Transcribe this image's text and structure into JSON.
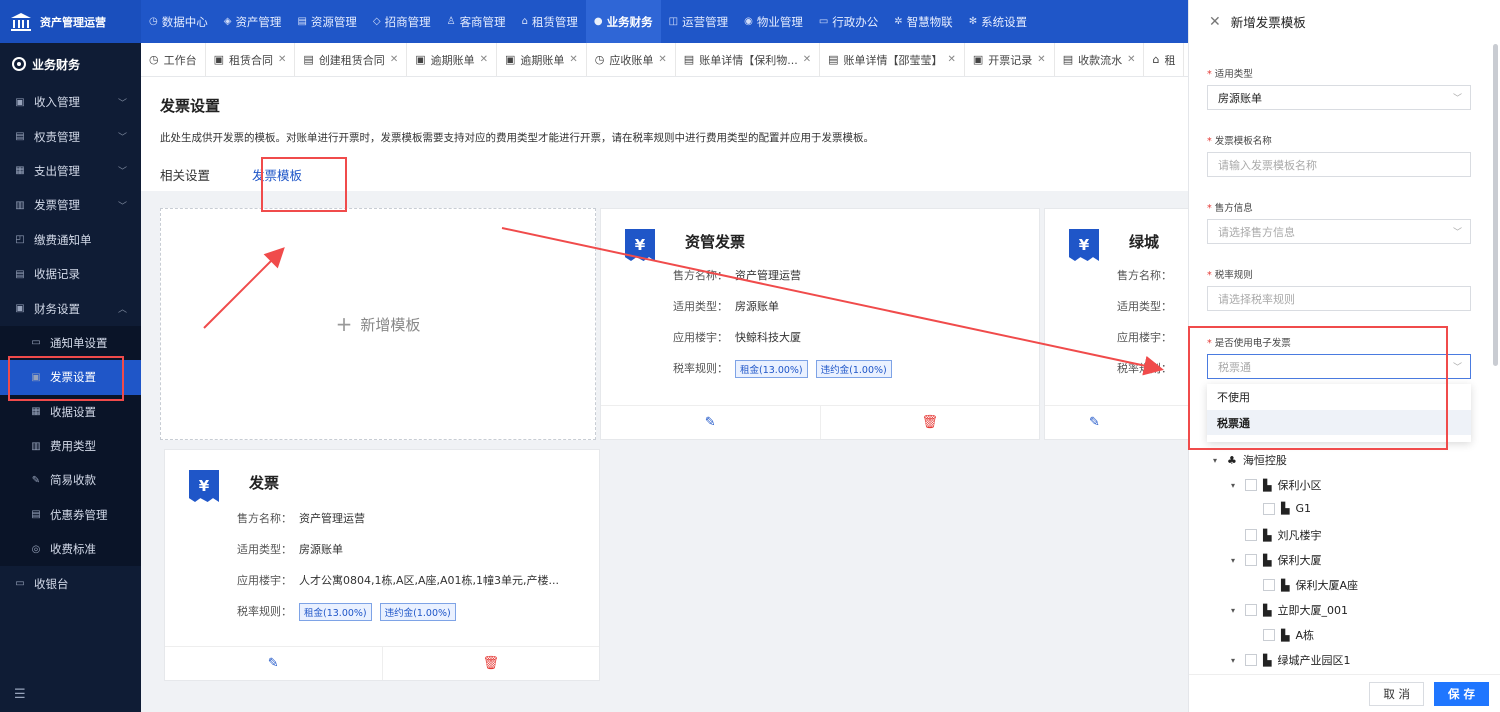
{
  "brand": {
    "name": "资产管理运营"
  },
  "topnav": [
    {
      "icon": "◷",
      "label": "数据中心"
    },
    {
      "icon": "◈",
      "label": "资产管理"
    },
    {
      "icon": "▤",
      "label": "资源管理"
    },
    {
      "icon": "◇",
      "label": "招商管理"
    },
    {
      "icon": "♙",
      "label": "客商管理"
    },
    {
      "icon": "⌂",
      "label": "租赁管理"
    },
    {
      "icon": "●",
      "label": "业务财务",
      "active": true
    },
    {
      "icon": "◫",
      "label": "运营管理"
    },
    {
      "icon": "◉",
      "label": "物业管理"
    },
    {
      "icon": "▭",
      "label": "行政办公"
    },
    {
      "icon": "✲",
      "label": "智慧物联"
    },
    {
      "icon": "✻",
      "label": "系统设置"
    }
  ],
  "sidebar": {
    "header": "业务财务",
    "items": [
      {
        "icon": "▣",
        "label": "收入管理",
        "chev": "﹀"
      },
      {
        "icon": "▤",
        "label": "权责管理",
        "chev": "﹀"
      },
      {
        "icon": "▦",
        "label": "支出管理",
        "chev": "﹀"
      },
      {
        "icon": "▥",
        "label": "发票管理",
        "chev": "﹀"
      },
      {
        "icon": "◰",
        "label": "缴费通知单"
      },
      {
        "icon": "▤",
        "label": "收据记录"
      },
      {
        "icon": "▣",
        "label": "财务设置",
        "chev": "︿"
      }
    ],
    "sub_items": [
      {
        "icon": "▭",
        "label": "通知单设置"
      },
      {
        "icon": "▣",
        "label": "发票设置",
        "active": true
      },
      {
        "icon": "▦",
        "label": "收据设置"
      },
      {
        "icon": "▥",
        "label": "费用类型"
      },
      {
        "icon": "✎",
        "label": "简易收款"
      },
      {
        "icon": "▤",
        "label": "优惠券管理"
      },
      {
        "icon": "◎",
        "label": "收费标准"
      }
    ],
    "last_item": {
      "icon": "▭",
      "label": "收银台"
    },
    "bottom_icon": "☰"
  },
  "tabs": [
    {
      "icon": "◷",
      "label": "工作台"
    },
    {
      "icon": "▣",
      "label": "租赁合同"
    },
    {
      "icon": "▤",
      "label": "创建租赁合同"
    },
    {
      "icon": "▣",
      "label": "逾期账单"
    },
    {
      "icon": "▣",
      "label": "逾期账单"
    },
    {
      "icon": "◷",
      "label": "应收账单"
    },
    {
      "icon": "▤",
      "label": "账单详情【保利物..."
    },
    {
      "icon": "▤",
      "label": "账单详情【邵莹莹】"
    },
    {
      "icon": "▣",
      "label": "开票记录"
    },
    {
      "icon": "▤",
      "label": "收款流水"
    },
    {
      "icon": "⌂",
      "label": "租"
    }
  ],
  "page": {
    "title": "发票设置",
    "desc": "此处生成供开发票的模板。对账单进行开票时，发票模板需要支持对应的费用类型才能进行开票，请在税率规则中进行费用类型的配置并应用于发票模板。",
    "tab_related": "相关设置",
    "tab_templates": "发票模板",
    "add_label": "新增模板",
    "add_icon": "+"
  },
  "cards": [
    {
      "icon": "¥",
      "title": "资管发票",
      "seller_label": "售方名称：",
      "seller": "资产管理运营",
      "type_label": "适用类型：",
      "type": "房源账单",
      "building_label": "应用楼宇：",
      "building": "快鲸科技大厦",
      "tax_label": "税率规则：",
      "tags": [
        "租金(13.00%)",
        "违约金(1.00%)"
      ],
      "edit_icon": "✎",
      "delete_icon": "🗑"
    },
    {
      "icon": "¥",
      "title": "绿城",
      "seller_label": "售方名称：",
      "type_label": "适用类型：",
      "building_label": "应用楼宇：",
      "tax_label": "税率规则：",
      "edit_icon": "✎"
    },
    {
      "icon": "¥",
      "title": "发票",
      "seller_label": "售方名称：",
      "seller": "资产管理运营",
      "type_label": "适用类型：",
      "type": "房源账单",
      "building_label": "应用楼宇：",
      "building": "人才公寓0804,1栋,A区,A座,A01栋,1幢3单元,产楼...",
      "tax_label": "税率规则：",
      "tags": [
        "租金(13.00%)",
        "违约金(1.00%)"
      ],
      "edit_icon": "✎",
      "delete_icon": "🗑"
    }
  ],
  "panel": {
    "title": "新增发票模板",
    "close_icon": "✕",
    "fields": {
      "type_label": "适用类型",
      "type_value": "房源账单",
      "name_label": "发票模板名称",
      "name_placeholder": "请输入发票模板名称",
      "seller_label": "售方信息",
      "seller_placeholder": "请选择售方信息",
      "tax_label": "税率规则",
      "tax_placeholder": "请选择税率规则",
      "einvoice_label": "是否使用电子发票",
      "einvoice_value": "税票通"
    },
    "dropdown_options": [
      "不使用",
      "税票通"
    ],
    "tree": [
      {
        "label": "海恒控股",
        "level": 0,
        "arrow": "▾",
        "icon": "♣",
        "checkbox": false
      },
      {
        "label": "保利小区",
        "level": 1,
        "arrow": "▾",
        "icon": "▙",
        "checkbox": true
      },
      {
        "label": "G1",
        "level": 2,
        "arrow": "",
        "icon": "▙",
        "checkbox": true
      },
      {
        "label": "刘凡楼宇",
        "level": 1,
        "arrow": "",
        "icon": "▙",
        "checkbox": true
      },
      {
        "label": "保利大厦",
        "level": 1,
        "arrow": "▾",
        "icon": "▙",
        "checkbox": true
      },
      {
        "label": "保利大厦A座",
        "level": 2,
        "arrow": "",
        "icon": "▙",
        "checkbox": true
      },
      {
        "label": "立即大厦_001",
        "level": 1,
        "arrow": "▾",
        "icon": "▙",
        "checkbox": true
      },
      {
        "label": "A栋",
        "level": 2,
        "arrow": "",
        "icon": "▙",
        "checkbox": true
      },
      {
        "label": "绿城产业园区1",
        "level": 1,
        "arrow": "▾",
        "icon": "▙",
        "checkbox": true
      }
    ],
    "cancel_label": "取 消",
    "save_label": "保 存"
  },
  "colors": {
    "primary": "#1f56c8",
    "annotation": "#f04b4b",
    "sidebar_bg": "#0f1c35"
  }
}
